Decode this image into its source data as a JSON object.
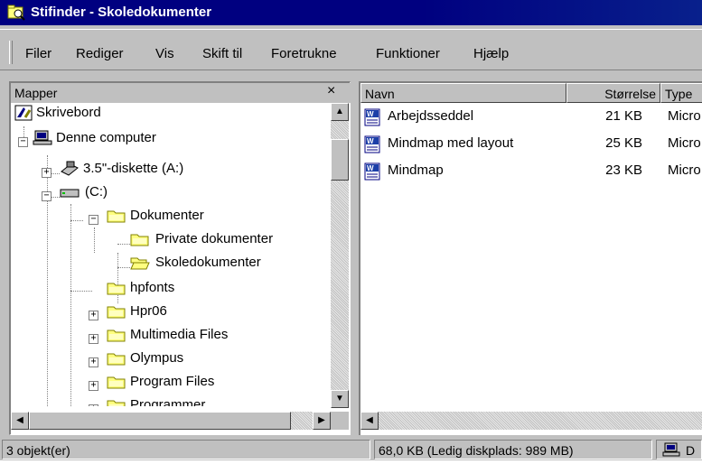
{
  "window": {
    "title": "Stifinder - Skoledokumenter",
    "title_icon": "explorer-icon"
  },
  "menu": [
    {
      "label": "Filer"
    },
    {
      "label": "Rediger"
    },
    {
      "label": "Vis"
    },
    {
      "label": "Skift til"
    },
    {
      "label": "Foretrukne"
    },
    {
      "label": "Funktioner"
    },
    {
      "label": "Hjælp"
    }
  ],
  "folders_pane": {
    "title": "Mapper",
    "close_glyph": "×",
    "tree": [
      {
        "label": "Skrivebord",
        "icon": "desktop-icon"
      },
      {
        "label": "Denne computer",
        "icon": "computer-icon",
        "expander": "−"
      },
      {
        "label": "3.5\"-diskette (A:)",
        "icon": "floppy-icon",
        "expander": "+"
      },
      {
        "label": "(C:)",
        "icon": "hard-drive-icon",
        "expander": "−"
      },
      {
        "label": "Dokumenter",
        "icon": "folder-icon",
        "expander": "−"
      },
      {
        "label": "Private dokumenter",
        "icon": "folder-icon"
      },
      {
        "label": "Skoledokumenter",
        "icon": "open-folder-icon"
      },
      {
        "label": "hpfonts",
        "icon": "folder-icon"
      },
      {
        "label": "Hpr06",
        "icon": "folder-icon",
        "expander": "+"
      },
      {
        "label": "Multimedia Files",
        "icon": "folder-icon",
        "expander": "+"
      },
      {
        "label": "Olympus",
        "icon": "folder-icon",
        "expander": "+"
      },
      {
        "label": "Program Files",
        "icon": "folder-icon",
        "expander": "+"
      },
      {
        "label": "Programmer",
        "icon": "folder-icon",
        "expander": "+"
      }
    ]
  },
  "files_pane": {
    "columns": [
      {
        "label": "Navn"
      },
      {
        "label": "Størrelse"
      },
      {
        "label": "Type"
      }
    ],
    "files": [
      {
        "name": "Arbejdsseddel",
        "size": "21 KB",
        "type": "Micro",
        "icon": "word-document-icon"
      },
      {
        "name": "Mindmap med layout",
        "size": "25 KB",
        "type": "Micro",
        "icon": "word-document-icon"
      },
      {
        "name": "Mindmap",
        "size": "23 KB",
        "type": "Micro",
        "icon": "word-document-icon"
      }
    ]
  },
  "status": {
    "objects": "3 objekt(er)",
    "disk": "68,0 KB (Ledig diskplads: 989 MB)",
    "location": "D"
  },
  "colors": {
    "titlebar": "#000080",
    "face": "#c0c0c0",
    "folder": "#ffff80",
    "word_icon": "#1c3fa8"
  }
}
